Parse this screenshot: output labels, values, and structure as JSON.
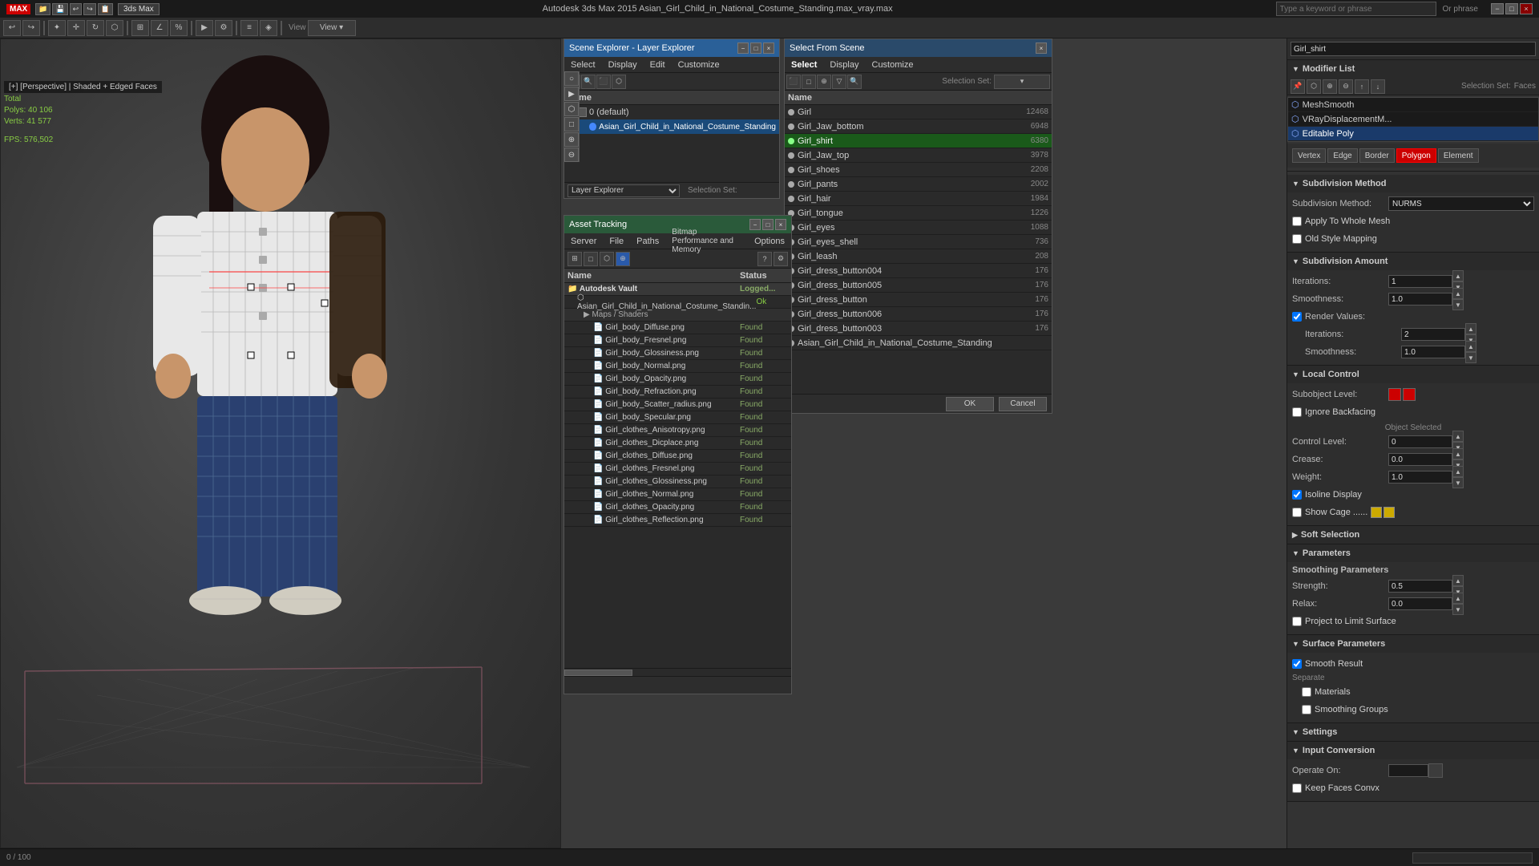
{
  "titlebar": {
    "app_name": "3ds Max",
    "title": "Autodesk 3ds Max 2015  Asian_Girl_Child_in_National_Costume_Standing.max_vray.max",
    "search_placeholder": "Type a keyword or phrase",
    "phrase_label": "Or phrase",
    "min_label": "−",
    "max_label": "□",
    "close_label": "×"
  },
  "viewport": {
    "label": "[+] [Perspective] | Shaded + Edged Faces",
    "stats_total": "Total",
    "stats_polys": "Polys:  40 106",
    "stats_verts": "Verts:  41 577",
    "fps_label": "FPS:",
    "fps_value": "576,502"
  },
  "status_bar": {
    "progress": "0 / 100"
  },
  "scene_explorer": {
    "title": "Scene Explorer - Layer Explorer",
    "menus": [
      "Select",
      "Display",
      "Edit",
      "Customize"
    ],
    "col_name": "Name",
    "layers": [
      {
        "name": "0 (default)",
        "type": "layer",
        "indent": 0,
        "expanded": false
      },
      {
        "name": "Asian_Girl_Child_in_National_Costume_Standing",
        "type": "object",
        "indent": 1,
        "selected": true
      }
    ],
    "footer_label": "Layer Explorer",
    "footer_sel": "Selection Set:"
  },
  "select_scene": {
    "title": "Select From Scene",
    "tabs": [
      "Select",
      "Display",
      "Customize"
    ],
    "sel_set_label": "Selection Set:",
    "col_name": "Name",
    "col_faces": "",
    "objects": [
      {
        "name": "Girl",
        "count": 12468,
        "type": "mesh"
      },
      {
        "name": "Girl_Jaw_bottom",
        "count": 6948,
        "type": "mesh"
      },
      {
        "name": "Girl_shirt",
        "count": 6380,
        "type": "mesh",
        "selected": true
      },
      {
        "name": "Girl_Jaw_top",
        "count": 3978,
        "type": "mesh"
      },
      {
        "name": "Girl_shoes",
        "count": 2208,
        "type": "mesh"
      },
      {
        "name": "Girl_pants",
        "count": 2002,
        "type": "mesh"
      },
      {
        "name": "Girl_hair",
        "count": 1984,
        "type": "mesh"
      },
      {
        "name": "Girl_tongue",
        "count": 1226,
        "type": "mesh"
      },
      {
        "name": "Girl_eyes",
        "count": 1088,
        "type": "mesh"
      },
      {
        "name": "Girl_eyes_shell",
        "count": 736,
        "type": "mesh"
      },
      {
        "name": "Girl_leash",
        "count": 208,
        "type": "mesh"
      },
      {
        "name": "Girl_dress_button004",
        "count": 176,
        "type": "mesh"
      },
      {
        "name": "Girl_dress_button005",
        "count": 176,
        "type": "mesh"
      },
      {
        "name": "Girl_dress_button",
        "count": 176,
        "type": "mesh"
      },
      {
        "name": "Girl_dress_button006",
        "count": 176,
        "type": "mesh"
      },
      {
        "name": "Girl_dress_button003",
        "count": 176,
        "type": "mesh"
      },
      {
        "name": "Asian_Girl_Child_in_National_Costume_Standing",
        "count": 0,
        "type": "group"
      }
    ],
    "ok_btn": "OK",
    "cancel_btn": "Cancel"
  },
  "asset_tracking": {
    "title": "Asset Tracking",
    "menus": [
      "Server",
      "File",
      "Paths",
      "Bitmap Performance and Memory",
      "Options"
    ],
    "col_name": "Name",
    "col_status": "Status",
    "assets": [
      {
        "name": "Autodesk Vault",
        "type": "root",
        "status": "Logged...",
        "indent": 0
      },
      {
        "name": "Asian_Girl_Child_in_National_Costume_Standin...",
        "type": "file",
        "status": "Ok",
        "indent": 1
      },
      {
        "name": "Maps / Shaders",
        "type": "group",
        "status": "",
        "indent": 2
      },
      {
        "name": "Girl_body_Diffuse.png",
        "type": "map",
        "status": "Found",
        "indent": 3
      },
      {
        "name": "Girl_body_Fresnel.png",
        "type": "map",
        "status": "Found",
        "indent": 3
      },
      {
        "name": "Girl_body_Glossiness.png",
        "type": "map",
        "status": "Found",
        "indent": 3
      },
      {
        "name": "Girl_body_Normal.png",
        "type": "map",
        "status": "Found",
        "indent": 3
      },
      {
        "name": "Girl_body_Opacity.png",
        "type": "map",
        "status": "Found",
        "indent": 3
      },
      {
        "name": "Girl_body_Refraction.png",
        "type": "map",
        "status": "Found",
        "indent": 3
      },
      {
        "name": "Girl_body_Scatter_radius.png",
        "type": "map",
        "status": "Found",
        "indent": 3
      },
      {
        "name": "Girl_body_Specular.png",
        "type": "map",
        "status": "Found",
        "indent": 3
      },
      {
        "name": "Girl_clothes_Anisotropy.png",
        "type": "map",
        "status": "Found",
        "indent": 3
      },
      {
        "name": "Girl_clothes_Dicplace.png",
        "type": "map",
        "status": "Found",
        "indent": 3
      },
      {
        "name": "Girl_clothes_Diffuse.png",
        "type": "map",
        "status": "Found",
        "indent": 3
      },
      {
        "name": "Girl_clothes_Fresnel.png",
        "type": "map",
        "status": "Found",
        "indent": 3
      },
      {
        "name": "Girl_clothes_Glossiness.png",
        "type": "map",
        "status": "Found",
        "indent": 3
      },
      {
        "name": "Girl_clothes_Normal.png",
        "type": "map",
        "status": "Found",
        "indent": 3
      },
      {
        "name": "Girl_clothes_Opacity.png",
        "type": "map",
        "status": "Found",
        "indent": 3
      },
      {
        "name": "Girl_clothes_Reflection.png",
        "type": "map",
        "status": "Found",
        "indent": 3
      }
    ]
  },
  "right_panel": {
    "object_name": "Girl_shirt",
    "modifier_list_label": "Modifier List",
    "modifiers": [
      {
        "name": "MeshSmooth",
        "selected": false
      },
      {
        "name": "VRayDisplacementM...",
        "selected": false
      },
      {
        "name": "Editable Poly",
        "selected": true
      }
    ],
    "sub_obj_labels": [
      "Vertex",
      "Edge",
      "Border",
      "Polygon",
      "Element"
    ],
    "selection_set_label": "Selection Set:",
    "sub_level_label": "Faces",
    "subdivision_method_label": "Subdivision Method",
    "method_label": "Subdivision Method:",
    "method_value": "NURMS",
    "apply_whole_mesh_label": "Apply To Whole Mesh",
    "old_style_mapping_label": "Old Style Mapping",
    "subdivision_amount_label": "Subdivision Amount",
    "iterations_label": "Iterations:",
    "iterations_value": "1",
    "smoothness_label": "Smoothness:",
    "smoothness_value": "1.0",
    "render_values_label": "Render Values:",
    "render_iter_label": "Iterations:",
    "render_iter_value": "2",
    "render_smooth_label": "Smoothness:",
    "render_smooth_value": "1.0",
    "local_control_label": "Local Control",
    "subobj_level_label": "Subobject Level:",
    "subobj_level_value": "",
    "object_selected_label": "Object Selected",
    "control_level_label": "Control Level:",
    "control_level_value": "0",
    "crease_label": "Crease:",
    "crease_value": "0.0",
    "weight_label": "Weight:",
    "weight_value": "1.0",
    "isoline_label": "Isoline Display",
    "show_cage_label": "Show Cage ......",
    "soft_selection_label": "Soft Selection",
    "parameters_label": "Parameters",
    "smoothing_params_label": "Smoothing Parameters",
    "strength_label": "Strength:",
    "strength_value": "0.5",
    "relax_label": "Relax:",
    "relax_value": "0.0",
    "project_limit_label": "Project to Limit Surface",
    "surface_params_label": "Surface Parameters",
    "smooth_result_label": "Smooth Result",
    "separate_label": "Separate",
    "materials_label": "Materials",
    "smoothing_groups_label": "Smoothing Groups",
    "settings_label": "Settings",
    "input_conversion_label": "Input Conversion",
    "operate_on_label": "Operate On:",
    "keep_faces_label": "Keep Faces Convx"
  }
}
